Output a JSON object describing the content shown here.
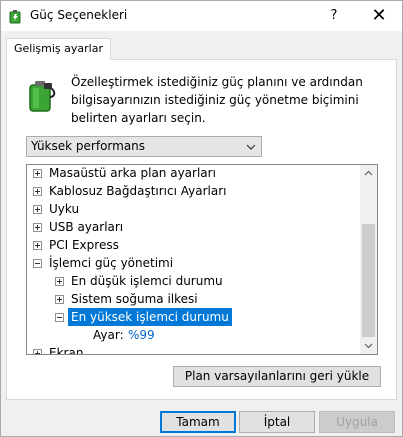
{
  "window": {
    "title": "Güç Seçenekleri",
    "help_glyph": "?",
    "close_glyph": "✕",
    "icon": "power-options-icon"
  },
  "tab": {
    "label": "Gelişmiş ayarlar"
  },
  "description": "Özelleştirmek istediğiniz güç planını ve ardından bilgisayarınızın istediğiniz güç yönetme biçimini belirten ayarları seçin.",
  "plan_select": {
    "value": "Yüksek performans"
  },
  "tree": {
    "items": [
      {
        "label": "Masaüstü arka plan ayarları",
        "state": "collapsed"
      },
      {
        "label": "Kablosuz Bağdaştırıcı Ayarları",
        "state": "collapsed"
      },
      {
        "label": "Uyku",
        "state": "collapsed"
      },
      {
        "label": "USB ayarları",
        "state": "collapsed"
      },
      {
        "label": "PCI Express",
        "state": "collapsed"
      },
      {
        "label": "İşlemci güç yönetimi",
        "state": "expanded"
      },
      {
        "label": "En düşük işlemci durumu",
        "state": "collapsed"
      },
      {
        "label": "Sistem soğuma ilkesi",
        "state": "collapsed"
      },
      {
        "label": "En yüksek işlemci durumu",
        "state": "expanded",
        "selected": true
      },
      {
        "label": "Ayar:",
        "value": "%99"
      },
      {
        "label": "Ekran",
        "state": "collapsed"
      }
    ]
  },
  "buttons": {
    "restore": "Plan varsayılanlarını geri yükle",
    "ok": "Tamam",
    "cancel": "İptal",
    "apply": "Uygula"
  },
  "colors": {
    "selection": "#0078d7",
    "value_text": "#0066cc",
    "battery_green": "#3aa435"
  }
}
